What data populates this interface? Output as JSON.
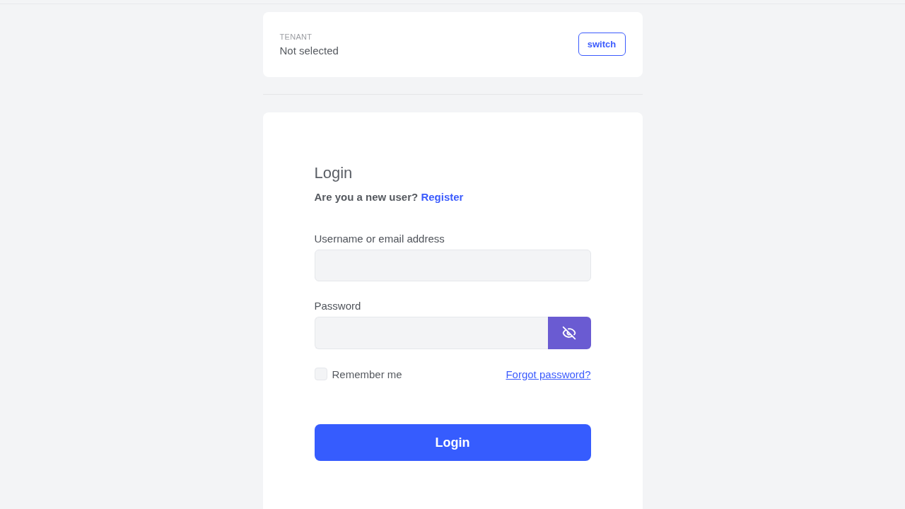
{
  "tenant": {
    "label": "TENANT",
    "value": "Not selected",
    "button": "switch"
  },
  "login": {
    "title": "Login",
    "prompt": "Are you a new user?",
    "register_link": "Register",
    "fields": [
      {
        "kind": "text",
        "label": "Username or email address"
      },
      {
        "kind": "password",
        "label": "Password",
        "visible": false
      }
    ],
    "remember_me": {
      "label": "Remember me",
      "checked": false
    },
    "forgot_link": "Forgot password?",
    "submit": "Login"
  }
}
